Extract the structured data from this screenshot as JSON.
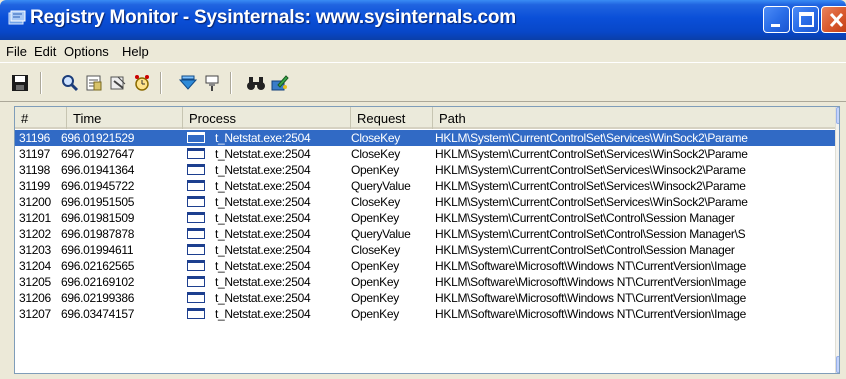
{
  "window": {
    "title": "Registry Monitor - Sysinternals: www.sysinternals.com"
  },
  "menu": {
    "file": "File",
    "edit": "Edit",
    "options": "Options",
    "help": "Help"
  },
  "toolbar": {
    "icons": [
      "save-icon",
      "search-icon",
      "filter-icon",
      "clear-icon",
      "timer-icon",
      "scroll-icon",
      "pin-icon",
      "find-icon",
      "jump-icon"
    ]
  },
  "columns": {
    "num": "#",
    "time": "Time",
    "process": "Process",
    "request": "Request",
    "path": "Path"
  },
  "rows": [
    {
      "num": "31196",
      "time": "696.01921529",
      "process": "t_Netstat.exe:2504",
      "request": "CloseKey",
      "path": "HKLM\\System\\CurrentControlSet\\Services\\WinSock2\\Parame",
      "selected": true
    },
    {
      "num": "31197",
      "time": "696.01927647",
      "process": "t_Netstat.exe:2504",
      "request": "CloseKey",
      "path": "HKLM\\System\\CurrentControlSet\\Services\\WinSock2\\Parame"
    },
    {
      "num": "31198",
      "time": "696.01941364",
      "process": "t_Netstat.exe:2504",
      "request": "OpenKey",
      "path": "HKLM\\System\\CurrentControlSet\\Services\\Winsock2\\Parame"
    },
    {
      "num": "31199",
      "time": "696.01945722",
      "process": "t_Netstat.exe:2504",
      "request": "QueryValue",
      "path": "HKLM\\System\\CurrentControlSet\\Services\\Winsock2\\Parame"
    },
    {
      "num": "31200",
      "time": "696.01951505",
      "process": "t_Netstat.exe:2504",
      "request": "CloseKey",
      "path": "HKLM\\System\\CurrentControlSet\\Services\\WinSock2\\Parame"
    },
    {
      "num": "31201",
      "time": "696.01981509",
      "process": "t_Netstat.exe:2504",
      "request": "OpenKey",
      "path": "HKLM\\System\\CurrentControlSet\\Control\\Session Manager"
    },
    {
      "num": "31202",
      "time": "696.01987878",
      "process": "t_Netstat.exe:2504",
      "request": "QueryValue",
      "path": "HKLM\\System\\CurrentControlSet\\Control\\Session Manager\\S"
    },
    {
      "num": "31203",
      "time": "696.01994611",
      "process": "t_Netstat.exe:2504",
      "request": "CloseKey",
      "path": "HKLM\\System\\CurrentControlSet\\Control\\Session Manager"
    },
    {
      "num": "31204",
      "time": "696.02162565",
      "process": "t_Netstat.exe:2504",
      "request": "OpenKey",
      "path": "HKLM\\Software\\Microsoft\\Windows NT\\CurrentVersion\\Image"
    },
    {
      "num": "31205",
      "time": "696.02169102",
      "process": "t_Netstat.exe:2504",
      "request": "OpenKey",
      "path": "HKLM\\Software\\Microsoft\\Windows NT\\CurrentVersion\\Image"
    },
    {
      "num": "31206",
      "time": "696.02199386",
      "process": "t_Netstat.exe:2504",
      "request": "OpenKey",
      "path": "HKLM\\Software\\Microsoft\\Windows NT\\CurrentVersion\\Image"
    },
    {
      "num": "31207",
      "time": "696.03474157",
      "process": "t_Netstat.exe:2504",
      "request": "OpenKey",
      "path": "HKLM\\Software\\Microsoft\\Windows NT\\CurrentVersion\\Image"
    }
  ],
  "colors": {
    "titlebar": "#0a4fd8",
    "selection": "#316ac5",
    "close": "#d95a2f"
  }
}
